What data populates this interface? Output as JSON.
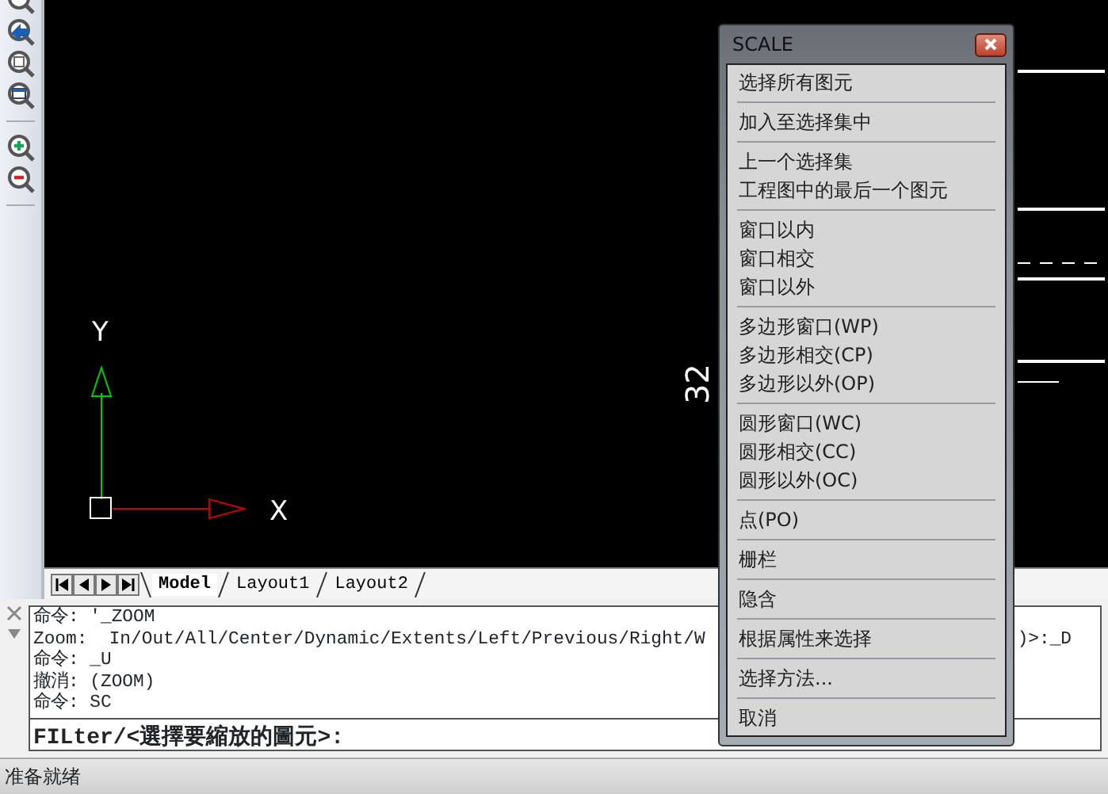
{
  "toolbar": {
    "tools": [
      {
        "kind": "zoom-partial"
      },
      {
        "kind": "zoom-previous"
      },
      {
        "kind": "zoom-window"
      },
      {
        "kind": "zoom-extents"
      },
      {
        "kind": "separator"
      },
      {
        "kind": "zoom-in"
      },
      {
        "kind": "zoom-out"
      },
      {
        "kind": "separator"
      }
    ]
  },
  "canvas": {
    "dimension_text": "32",
    "axis_y_label": "Y",
    "axis_x_label": "X"
  },
  "layout_tabs": [
    {
      "label": "Model",
      "selected": true
    },
    {
      "label": "Layout1",
      "selected": false
    },
    {
      "label": "Layout2",
      "selected": false
    }
  ],
  "command_history": [
    "命令: '_ZOOM",
    "Zoom:  In/Out/All/Center/Dynamic/Extents/Left/Previous/Right/W",
    "命令: _U",
    "撤消: (ZOOM)",
    "命令: SC"
  ],
  "command_history_tail": ")>:_D",
  "command_prompt": "FILter/<選擇要縮放的圖元>:",
  "status_bar": "准备就绪",
  "popup_menu": {
    "title": "SCALE",
    "groups": [
      [
        "选择所有图元"
      ],
      [
        "加入至选择集中"
      ],
      [
        "上一个选择集",
        "工程图中的最后一个图元"
      ],
      [
        "窗口以内",
        "窗口相交",
        "窗口以外"
      ],
      [
        "多边形窗口(WP)",
        "多边形相交(CP)",
        "多边形以外(OP)"
      ],
      [
        "圆形窗口(WC)",
        "圆形相交(CC)",
        "圆形以外(OC)"
      ],
      [
        "点(PO)"
      ],
      [
        "栅栏"
      ],
      [
        "隐含"
      ],
      [
        "根据属性来选择"
      ],
      [
        "选择方法..."
      ],
      [
        "取消"
      ]
    ]
  }
}
